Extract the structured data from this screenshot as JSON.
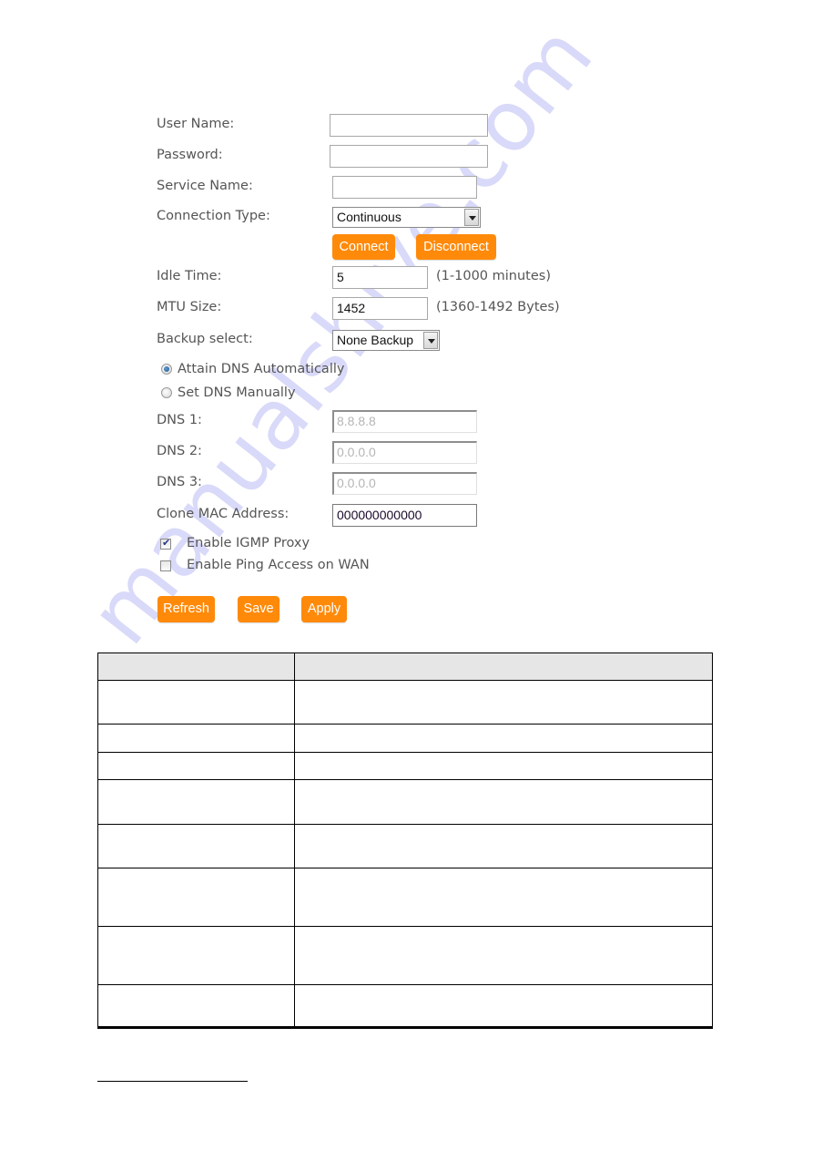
{
  "form": {
    "username": {
      "label": "User Name:",
      "value": ""
    },
    "password": {
      "label": "Password:",
      "value": ""
    },
    "service_name": {
      "label": "Service Name:",
      "value": ""
    },
    "connection_type": {
      "label": "Connection Type:",
      "selected": "Continuous"
    },
    "connect_button": "Connect",
    "disconnect_button": "Disconnect",
    "idle_time": {
      "label": "Idle Time:",
      "value": "5",
      "hint": "(1-1000 minutes)"
    },
    "mtu_size": {
      "label": "MTU Size:",
      "value": "1452",
      "hint": "(1360-1492 Bytes)"
    },
    "backup_select": {
      "label": "Backup select:",
      "selected": "None Backup"
    },
    "dns_mode": {
      "options": [
        {
          "label": "Attain DNS Automatically",
          "selected": true
        },
        {
          "label": "Set DNS Manually",
          "selected": false
        }
      ]
    },
    "dns1": {
      "label": "DNS 1:",
      "value": "8.8.8.8"
    },
    "dns2": {
      "label": "DNS 2:",
      "value": "0.0.0.0"
    },
    "dns3": {
      "label": "DNS 3:",
      "value": "0.0.0.0"
    },
    "clone_mac": {
      "label": "Clone MAC Address:",
      "value": "000000000000"
    },
    "igmp_proxy": {
      "label": "Enable IGMP Proxy",
      "checked": true
    },
    "ping_wan": {
      "label": "Enable Ping Access on WAN",
      "checked": false
    },
    "refresh_button": "Refresh",
    "save_button": "Save",
    "apply_button": "Apply"
  },
  "table": {
    "header": [
      "",
      ""
    ],
    "rows": [
      [
        "",
        ""
      ],
      [
        "",
        ""
      ],
      [
        "",
        ""
      ],
      [
        "",
        ""
      ],
      [
        "",
        ""
      ],
      [
        "",
        ""
      ],
      [
        "",
        ""
      ],
      [
        "",
        ""
      ]
    ]
  },
  "watermark": "manualshive.com",
  "colors": {
    "button": "#ff8a0a",
    "label": "#555555",
    "table_header": "#e6e6e6"
  }
}
